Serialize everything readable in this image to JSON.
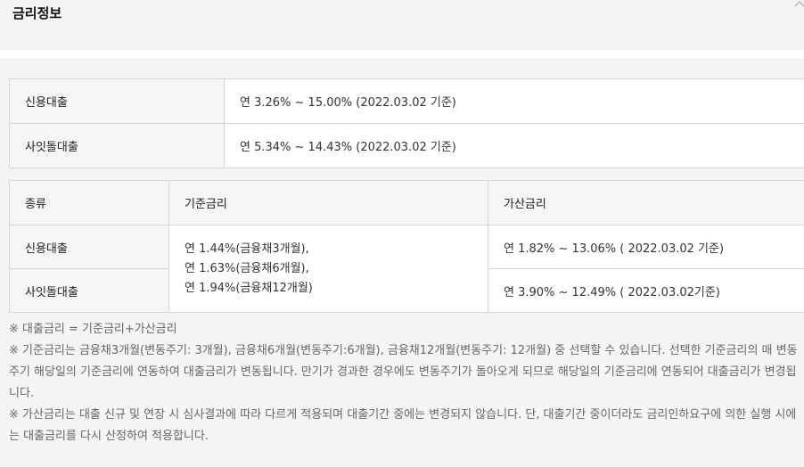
{
  "header": {
    "title": "금리정보"
  },
  "summary_table": [
    {
      "label": "신용대출",
      "value": "연 3.26% ~ 15.00% (2022.03.02 기준)"
    },
    {
      "label": "사잇돌대출",
      "value": "연 5.34% ~ 14.43% (2022.03.02 기준)"
    }
  ],
  "detail_table": {
    "headers": [
      "종류",
      "기준금리",
      "가산금리"
    ],
    "base_rate_lines": [
      "연 1.44%(금융채3개월),",
      "연 1.63%(금융채6개월),",
      "연 1.94%(금융채12개월)"
    ],
    "rows": [
      {
        "label": "신용대출",
        "additional": "연 1.82% ~ 13.06% ( 2022.03.02 기준)"
      },
      {
        "label": "사잇돌대출",
        "additional": "연 3.90% ~ 12.49% ( 2022.03.02기준)"
      }
    ]
  },
  "notes": [
    "※ 대출금리 = 기준금리+가산금리",
    "※ 기준금리는 금융채3개월(변동주기: 3개월), 금융채6개월(변동주기:6개월), 금융채12개월(변동주기: 12개월) 중 선택할 수 있습니다. 선택한 기준금리의 매 변동주기 해당일의 기준금리에 연동하여 대출금리가 변동됩니다. 만기가 경과한 경우에도 변동주기가 돌아오게 되므로 해당일의 기준금리에 연동되어 대출금리가 변경됩니다.",
    "※ 가산금리는 대출 신규 및 연장 시 심사결과에 따라 다르게 적용되며 대출기간 중에는 변경되지 않습니다. 단, 대출기간 중이더라도 금리인하요구에 의한 실행 시에는 대출금리를 다시 산정하여 적용합니다."
  ]
}
